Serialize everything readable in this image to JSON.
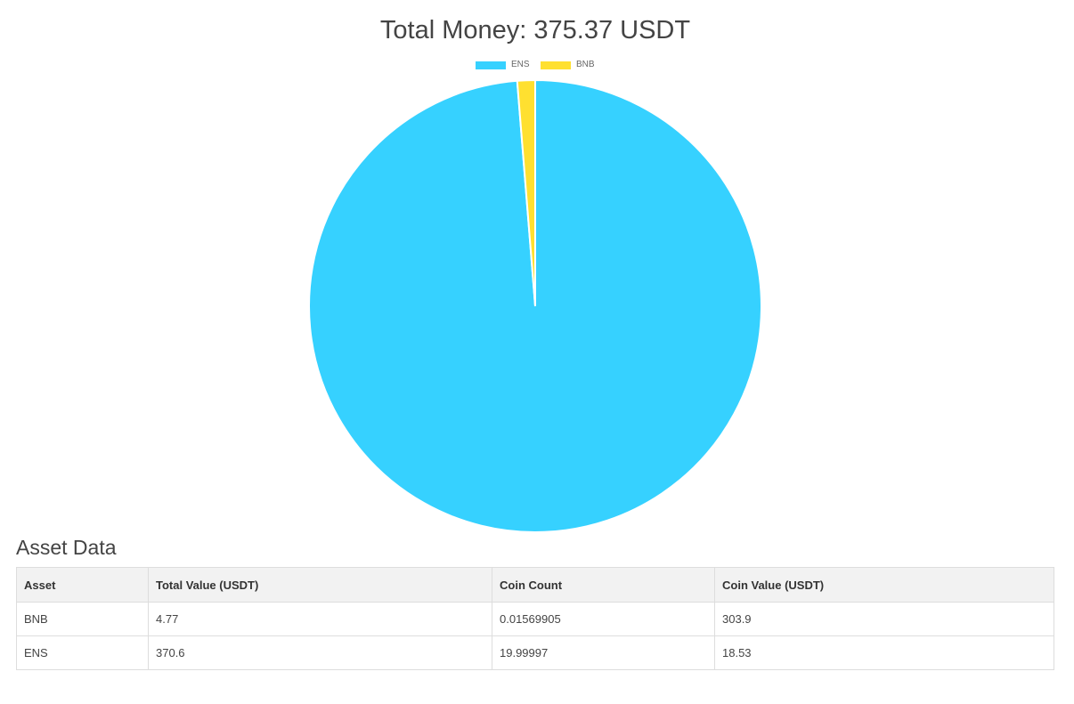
{
  "chart_data": {
    "type": "pie",
    "title": "Total Money: 375.37 USDT",
    "legend_position": "top",
    "series": [
      {
        "name": "ENS",
        "value": 370.6,
        "color": "#36d1ff"
      },
      {
        "name": "BNB",
        "value": 4.77,
        "color": "#ffe030"
      }
    ]
  },
  "section_title": "Asset Data",
  "table": {
    "headers": [
      "Asset",
      "Total Value (USDT)",
      "Coin Count",
      "Coin Value (USDT)"
    ],
    "rows": [
      [
        "BNB",
        "4.77",
        "0.01569905",
        "303.9"
      ],
      [
        "ENS",
        "370.6",
        "19.99997",
        "18.53"
      ]
    ]
  }
}
